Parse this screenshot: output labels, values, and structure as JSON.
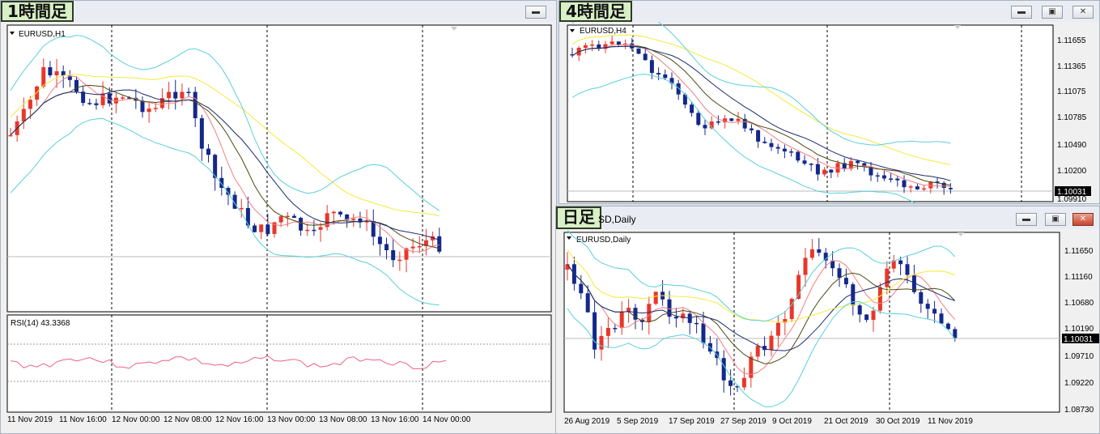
{
  "windows": {
    "h1": {
      "label": "1時間足",
      "chart_label": "EURUSD,H1",
      "rsi_label": "RSI(14) 43.3368",
      "x_labels": [
        "11 Nov 2019",
        "11 Nov 16:00",
        "12 Nov 00:00",
        "12 Nov 08:00",
        "12 Nov 16:00",
        "13 Nov 00:00",
        "13 Nov 08:00",
        "13 Nov 16:00",
        "14 Nov 00:00"
      ],
      "minimize_icon": "minimize-icon"
    },
    "h4": {
      "label": "4時間足",
      "chart_label": "EURUSD,H4",
      "y_labels": [
        "1.11655",
        "1.11365",
        "1.11075",
        "1.10785",
        "1.10490",
        "1.10200",
        "1.09910"
      ],
      "price_tag": "1.10031"
    },
    "daily": {
      "label": "日足",
      "title": "SD,Daily",
      "chart_label": "EURUSD,Daily",
      "y_labels": [
        "1.11650",
        "1.11160",
        "1.10680",
        "1.10190",
        "1.09710",
        "1.09220",
        "1.08730"
      ],
      "price_tag": "1.10031",
      "x_labels": [
        "26 Aug 2019",
        "5 Sep 2019",
        "17 Sep 2019",
        "27 Sep 2019",
        "9 Oct 2019",
        "21 Oct 2019",
        "30 Oct 2019",
        "11 Nov 2019"
      ]
    }
  },
  "colors": {
    "bull": "#e8372a",
    "bear": "#14288a",
    "bb": "#5ad0d8",
    "ma_slow": "#f3ea3a",
    "ma_mid": "#1b2b6e",
    "ma_fast": "#f08080",
    "ma_dark": "#4a4a10",
    "rsi": "#f06080"
  },
  "chart_data": [
    {
      "type": "candlestick",
      "title": "EURUSD,H1",
      "x_ticks": [
        "11 Nov 2019",
        "11 Nov 16:00",
        "12 Nov 00:00",
        "12 Nov 08:00",
        "12 Nov 16:00",
        "13 Nov 00:00",
        "13 Nov 08:00",
        "13 Nov 16:00",
        "14 Nov 00:00"
      ],
      "indicator": "RSI(14)",
      "rsi_last": 43.3368
    },
    {
      "type": "candlestick",
      "title": "EURUSD,H4",
      "y_ticks": [
        1.11655,
        1.11365,
        1.11075,
        1.10785,
        1.1049,
        1.102,
        1.0991
      ],
      "last_price": 1.10031
    },
    {
      "type": "candlestick",
      "title": "EURUSD,Daily",
      "y_ticks": [
        1.1165,
        1.1116,
        1.1068,
        1.1019,
        1.0971,
        1.0922,
        1.0873
      ],
      "x_ticks": [
        "26 Aug 2019",
        "5 Sep 2019",
        "17 Sep 2019",
        "27 Sep 2019",
        "9 Oct 2019",
        "21 Oct 2019",
        "30 Oct 2019",
        "11 Nov 2019"
      ],
      "last_price": 1.10031
    }
  ]
}
